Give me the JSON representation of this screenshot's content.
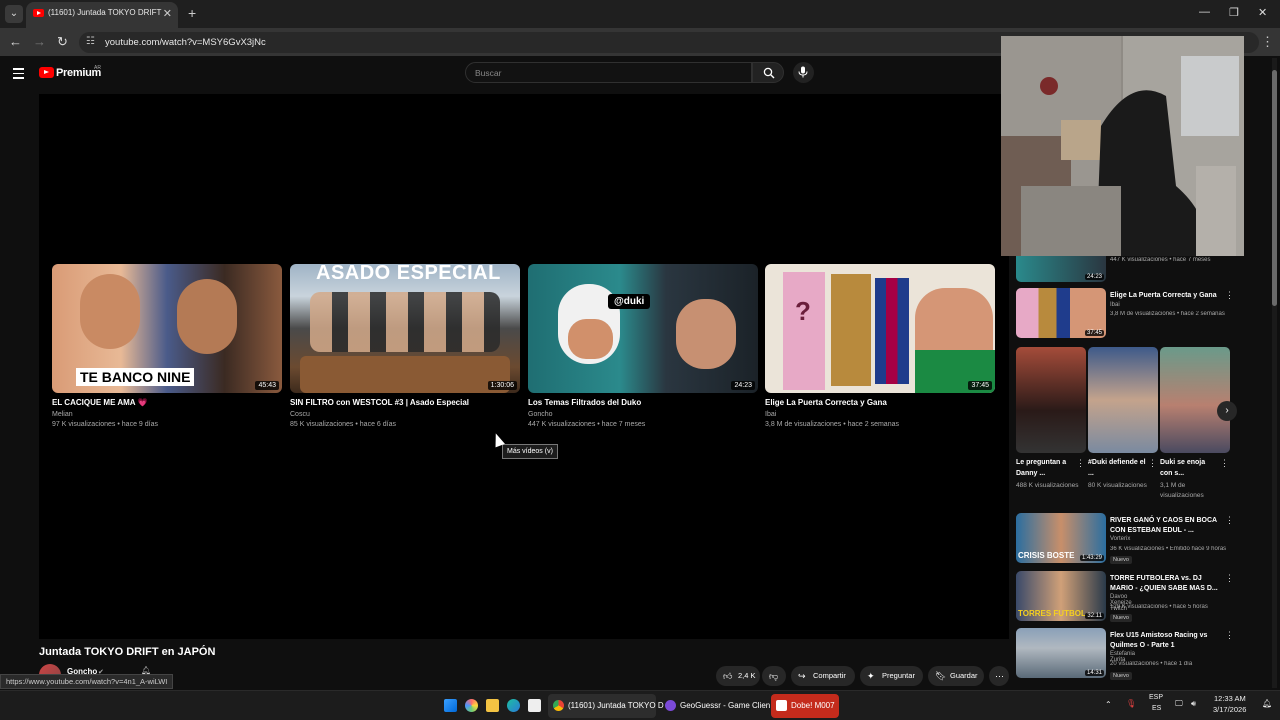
{
  "browser": {
    "tab_title": "(11601) Juntada TOKYO DRIFT en JAPÓN - YouTube",
    "url": "youtube.com/watch?v=MSY6GvX3jNc",
    "status_url": "https://www.youtube.com/watch?v=4n1_A-wiLWI"
  },
  "youtube": {
    "brand": "Premium",
    "region": "AR",
    "search_placeholder": "Buscar"
  },
  "endscreen": {
    "cards": [
      {
        "title": "EL CACIQUE ME AMA 💗",
        "channel": "Melian",
        "views": "97 K visualizaciones",
        "age": "hace 9 días",
        "duration": "45:43",
        "thumb_caption": "TE BANCO NINE"
      },
      {
        "title": "SIN FILTRO con WESTCOL #3 | Asado Especial",
        "channel": "Coscu",
        "views": "85 K visualizaciones",
        "age": "hace 6 días",
        "duration": "1:30:06",
        "thumb_caption": "ASADO ESPECIAL"
      },
      {
        "title": "Los Temas Filtrados del Duko",
        "channel": "Goncho",
        "views": "447 K visualizaciones",
        "age": "hace 7 meses",
        "duration": "24:23",
        "thumb_caption": "@duki"
      },
      {
        "title": "Elige La Puerta Correcta y Gana",
        "channel": "Ibai",
        "views": "3,8 M de visualizaciones",
        "age": "hace 2 semanas",
        "duration": "37:45",
        "thumb_caption": ""
      }
    ],
    "tooltip": "Más vídeos (v)"
  },
  "video": {
    "title": "Juntada TOKYO DRIFT en JAPÓN",
    "channel": "Goncho",
    "likes": "2,4 K",
    "share": "Compartir",
    "ask": "Preguntar",
    "save": "Guardar"
  },
  "sidebar": {
    "partial_meta": "447 K visualizaciones • hace 7 meses",
    "partial_duration": "24:23",
    "items": [
      {
        "title": "Elige La Puerta Correcta y Gana",
        "channel": "Ibai",
        "meta": "3,8 M de visualizaciones • hace 2 semanas",
        "duration": "37:45",
        "badge": ""
      },
      {
        "title": "RIVER GANÓ Y CAOS EN BOCA CON ESTEBAN EDUL - ...",
        "channel": "Vorterix",
        "meta": "36 K visualizaciones • Emitido hace 9 horas",
        "duration": "1:43:29",
        "badge": "Nuevo",
        "thumb_caption": "CRISIS BOSTE"
      },
      {
        "title": "TORRE FUTBOLERA vs. DJ MARIO - ¿QUIEN SABE MAS D...",
        "channel": "Davoo Xeneize Twitch",
        "meta": "129 K visualizaciones • hace 5 horas",
        "duration": "32:11",
        "badge": "Nuevo",
        "thumb_caption": "TORRES FUTBOL"
      },
      {
        "title": "Flex U15 Amistoso Racing vs Quilmes O - Parte 1",
        "channel": "Estefania Zurita",
        "meta": "20 visualizaciones • hace 1 día",
        "duration": "14:31",
        "badge": "Nuevo"
      }
    ],
    "shorts": [
      {
        "title": "Le preguntan a Danny ...",
        "views": "488 K visualizaciones"
      },
      {
        "title": "#Duki defiende el ...",
        "views": "80 K visualizaciones"
      },
      {
        "title": "Duki se enoja con s...",
        "views": "3,1 M de visualizaciones"
      }
    ]
  },
  "taskbar": {
    "apps": [
      {
        "label": "(11601) Juntada TOKYO D"
      },
      {
        "label": "GeoGuessr - Game Clien"
      },
      {
        "label": "Dobe! M007"
      }
    ],
    "lang": "ESP",
    "lang2": "ES",
    "time": "12:33 AM",
    "date": "3/17/2026"
  },
  "colors": {
    "accent_red": "#ff0000",
    "background": "#0f0f0f",
    "active_app": "#c42b1c"
  }
}
